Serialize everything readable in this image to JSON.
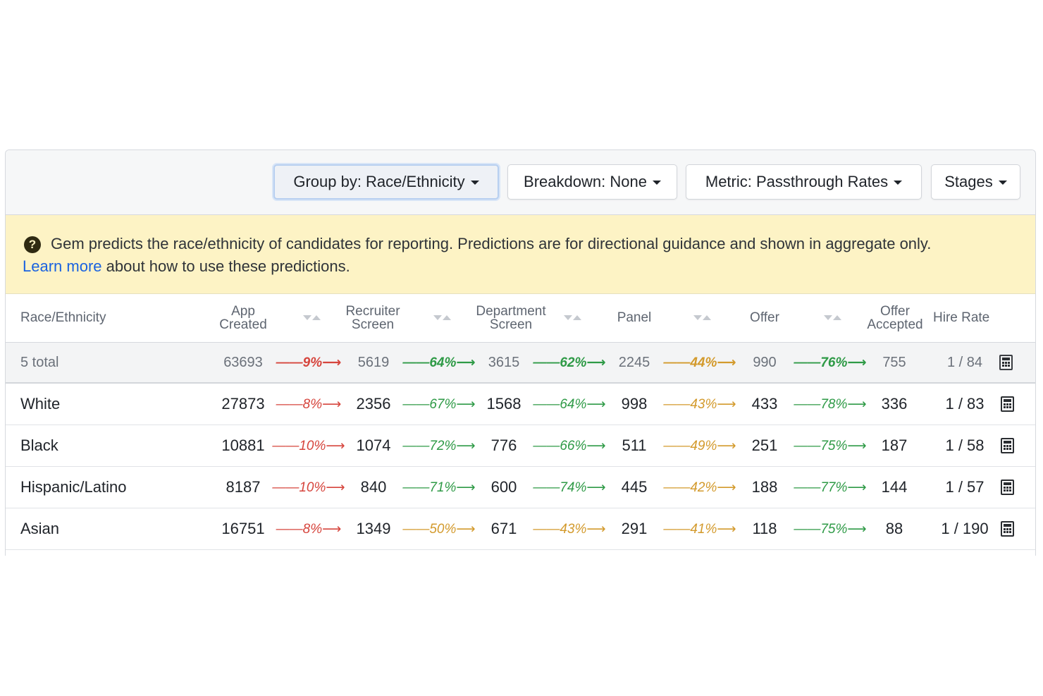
{
  "toolbar": {
    "group_by": "Group by: Race/Ethnicity",
    "breakdown": "Breakdown: None",
    "metric": "Metric: Passthrough Rates",
    "stages": "Stages"
  },
  "banner": {
    "icon": "question-circle-icon",
    "text": "Gem predicts the race/ethnicity of candidates for reporting. Predictions are for directional guidance and shown in aggregate only.",
    "link": "Learn more",
    "text_after_link": " about how to use these predictions."
  },
  "table": {
    "headers": {
      "group": "Race/Ethnicity",
      "app_created_1": "App",
      "app_created_2": "Created",
      "recruiter_screen_1": "Recruiter",
      "recruiter_screen_2": "Screen",
      "department_screen_1": "Department",
      "department_screen_2": "Screen",
      "panel": "Panel",
      "offer": "Offer",
      "offer_accepted_1": "Offer",
      "offer_accepted_2": "Accepted",
      "hire_rate": "Hire Rate"
    },
    "total": {
      "label": "5 total",
      "app_created": "63693",
      "r1": "——9%⟶",
      "recruiter_screen": "5619",
      "r2": "——64%⟶",
      "department_screen": "3615",
      "r3": "——62%⟶",
      "panel": "2245",
      "r4": "——44%⟶",
      "offer": "990",
      "r5": "——76%⟶",
      "offer_accepted": "755",
      "hire_rate": "1 / 84"
    },
    "rows": [
      {
        "label": "White",
        "app_created": "27873",
        "r1": "——8%⟶",
        "recruiter_screen": "2356",
        "r2": "——67%⟶",
        "department_screen": "1568",
        "r3": "——64%⟶",
        "panel": "998",
        "r4": "——43%⟶",
        "offer": "433",
        "r5": "——78%⟶",
        "offer_accepted": "336",
        "hire_rate": "1 / 83"
      },
      {
        "label": "Black",
        "app_created": "10881",
        "r1": "——10%⟶",
        "recruiter_screen": "1074",
        "r2": "——72%⟶",
        "department_screen": "776",
        "r3": "——66%⟶",
        "panel": "511",
        "r4": "——49%⟶",
        "offer": "251",
        "r5": "——75%⟶",
        "offer_accepted": "187",
        "hire_rate": "1 / 58"
      },
      {
        "label": "Hispanic/Latino",
        "app_created": "8187",
        "r1": "——10%⟶",
        "recruiter_screen": "840",
        "r2": "——71%⟶",
        "department_screen": "600",
        "r3": "——74%⟶",
        "panel": "445",
        "r4": "——42%⟶",
        "offer": "188",
        "r5": "——77%⟶",
        "offer_accepted": "144",
        "hire_rate": "1 / 57"
      },
      {
        "label": "Asian",
        "app_created": "16751",
        "r1": "——8%⟶",
        "recruiter_screen": "1349",
        "r2": "——50%⟶",
        "department_screen": "671",
        "r3": "——43%⟶",
        "panel": "291",
        "r4": "——41%⟶",
        "offer": "118",
        "r5": "——75%⟶",
        "offer_accepted": "88",
        "hire_rate": "1 / 190"
      }
    ],
    "colors": {
      "low": "#d6453d",
      "high": "#2e9a46",
      "mid": "#d39a2c"
    },
    "rate_colors": {
      "total": [
        "red",
        "green",
        "green",
        "orange",
        "green"
      ],
      "rows": [
        [
          "red",
          "green",
          "green",
          "orange",
          "green"
        ],
        [
          "red",
          "green",
          "green",
          "orange",
          "green"
        ],
        [
          "red",
          "green",
          "green",
          "orange",
          "green"
        ],
        [
          "red",
          "orange",
          "orange",
          "orange",
          "green"
        ]
      ]
    }
  }
}
